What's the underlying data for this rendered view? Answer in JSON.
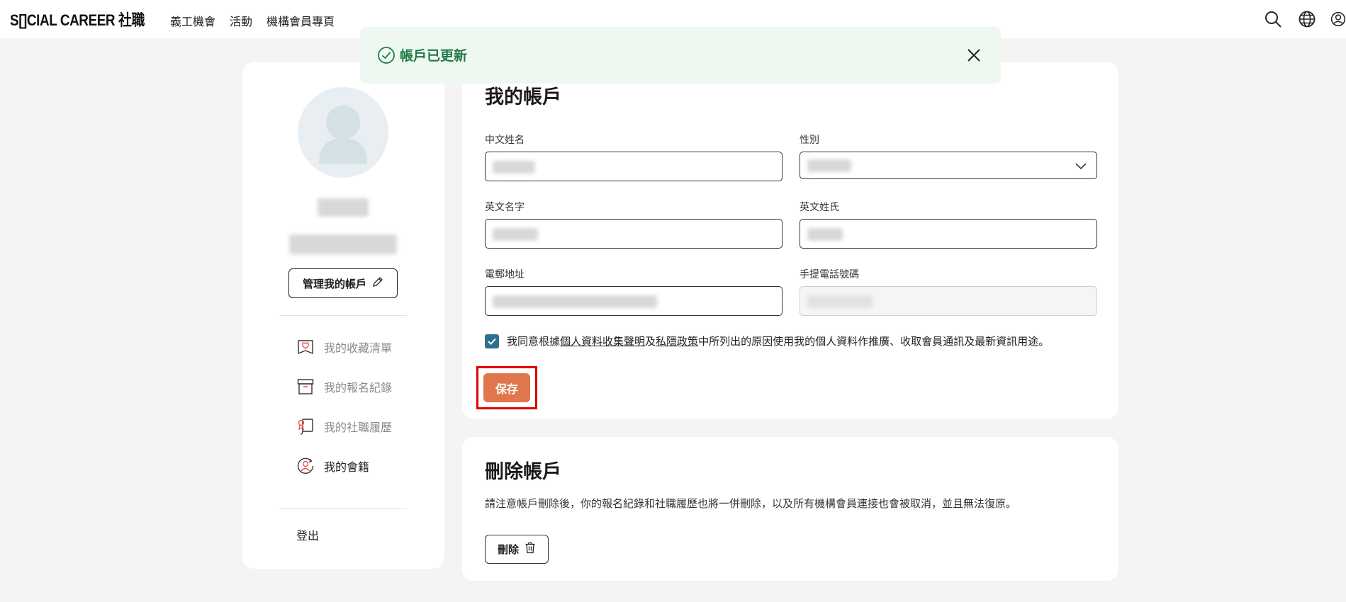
{
  "header": {
    "logo": "S[]CIAL CAREER 社職",
    "nav": [
      "義工機會",
      "活動",
      "機構會員專頁"
    ],
    "icons": [
      "search-icon",
      "globe-icon",
      "user-icon"
    ]
  },
  "toast": {
    "message": "帳戶已更新",
    "status_color": "#1f7a47"
  },
  "sidebar": {
    "manage_label": "管理我的帳戶",
    "items": [
      {
        "label": "我的收藏清單",
        "icon": "bookmark-heart-icon"
      },
      {
        "label": "我的報名紀錄",
        "icon": "archive-box-icon"
      },
      {
        "label": "我的社職履歷",
        "icon": "resume-icon"
      },
      {
        "label": "我的會籍",
        "icon": "membership-icon"
      }
    ],
    "logout_label": "登出"
  },
  "account": {
    "title": "我的帳戶",
    "fields": {
      "chinese_name": {
        "label": "中文姓名"
      },
      "gender": {
        "label": "性別"
      },
      "english_first_name": {
        "label": "英文名字"
      },
      "english_last_name": {
        "label": "英文姓氏"
      },
      "email": {
        "label": "電郵地址"
      },
      "mobile": {
        "label": "手提電話號碼"
      }
    },
    "consent": {
      "prefix": "我同意根據",
      "link1": "個人資料收集聲明",
      "mid": "及",
      "link2": "私隱政策",
      "suffix": "中所列出的原因使用我的個人資料作推廣、收取會員通訊及最新資訊用途。",
      "checked": true
    },
    "save_label": "保存"
  },
  "delete_section": {
    "title": "刪除帳戶",
    "note": "請注意帳戶刪除後，你的報名紀錄和社職履歷也將一併刪除，以及所有機構會員連接也會被取消，並且無法復原。",
    "delete_label": "刪除"
  },
  "colors": {
    "accent": "#e0774c",
    "highlight": "#e00000",
    "checkbox": "#2f6f8f"
  }
}
